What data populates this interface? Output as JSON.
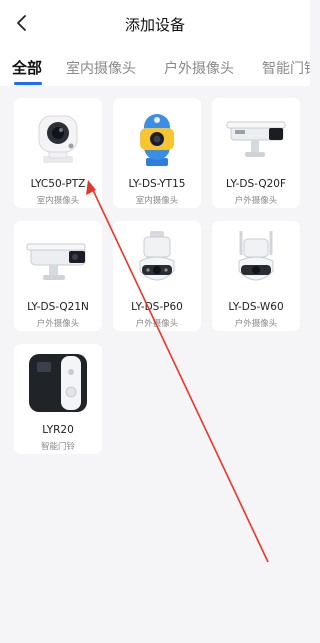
{
  "header": {
    "title": "添加设备",
    "back_icon": "chevron-left-icon"
  },
  "tabs": [
    "全部",
    "室内摄像头",
    "户外摄像头",
    "智能门铃"
  ],
  "devices": [
    {
      "name": "LYC50-PTZ",
      "category": "室内摄像头",
      "icon": "ptz-camera-icon"
    },
    {
      "name": "LY-DS-YT15",
      "category": "室内摄像头",
      "icon": "kids-camera-icon"
    },
    {
      "name": "LY-DS-Q20F",
      "category": "户外摄像头",
      "icon": "bullet-camera-icon"
    },
    {
      "name": "LY-DS-Q21N",
      "category": "户外摄像头",
      "icon": "bullet-camera-icon"
    },
    {
      "name": "LY-DS-P60",
      "category": "户外摄像头",
      "icon": "dome-camera-icon"
    },
    {
      "name": "LY-DS-W60",
      "category": "户外摄像头",
      "icon": "dome-camera-icon"
    },
    {
      "name": "LYR20",
      "category": "智能门铃",
      "icon": "doorbell-icon"
    }
  ],
  "colors": {
    "accent": "#1e6cff",
    "annotation": "#e8362b",
    "background": "#f5f5f7"
  }
}
